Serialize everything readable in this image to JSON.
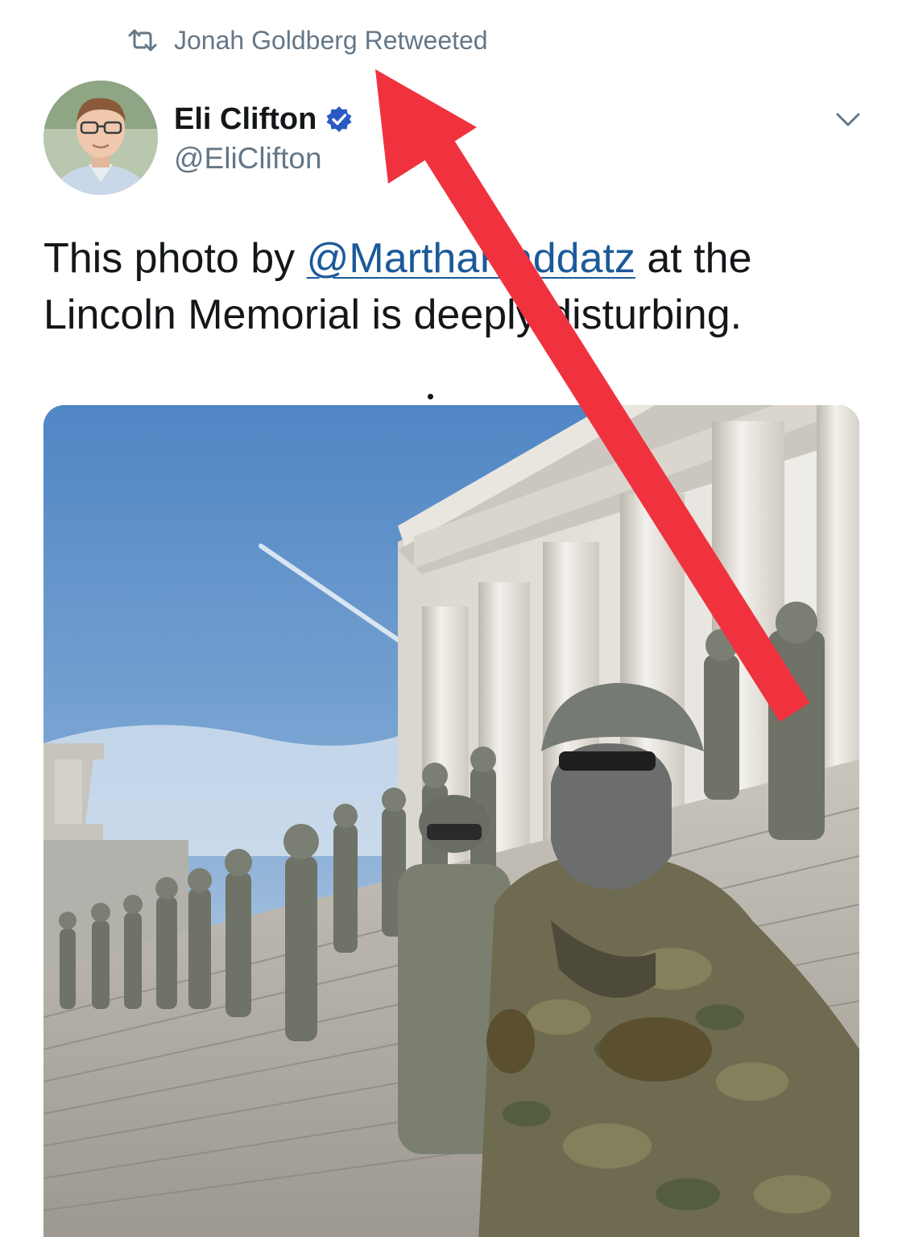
{
  "retweet": {
    "icon": "retweet-icon",
    "text": "Jonah Goldberg Retweeted"
  },
  "author": {
    "display_name": "Eli Clifton",
    "handle": "@EliClifton",
    "verified_icon": "verified-badge-icon",
    "verified_color": "#2a59c4"
  },
  "menu": {
    "icon": "chevron-down-icon"
  },
  "tweet": {
    "text_before": "This photo by ",
    "mention": "@MarthaRaddatz",
    "text_after": " at the Lincoln Memorial is deeply disturbing.",
    "mention_color": "#1b5a9a"
  },
  "media": {
    "type": "photo",
    "subject": "Lincoln Memorial steps with uniformed troops"
  },
  "annotation": {
    "icon": "red-arrow-icon",
    "color": "#f0323f"
  }
}
